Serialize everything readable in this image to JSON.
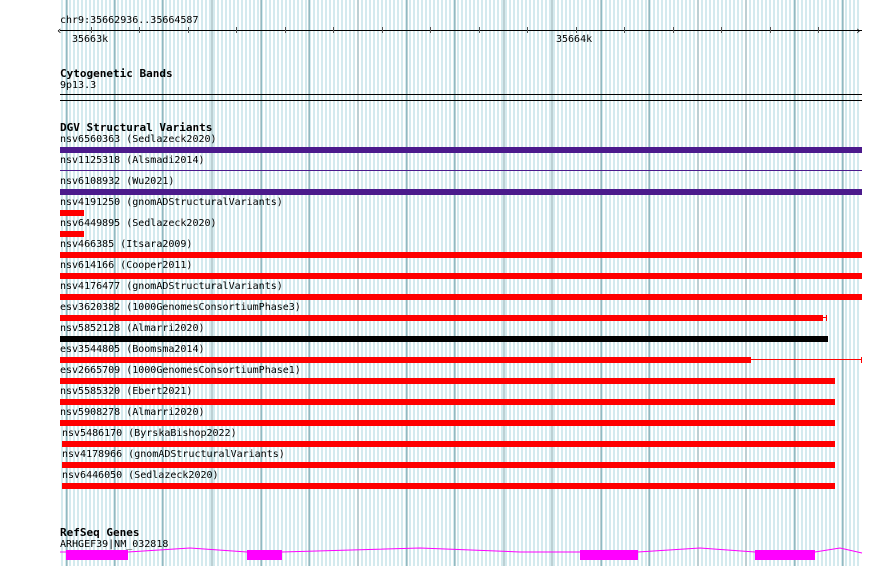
{
  "ruler": {
    "location": "chr9:35662936..35664587",
    "tick_labels": [
      "35663k",
      "35664k"
    ]
  },
  "cyto": {
    "title": "Cytogenetic Bands",
    "band": "9p13.3"
  },
  "dgv": {
    "title": "DGV Structural Variants",
    "variants": [
      {
        "label": "nsv6560363 (Sedlazeck2020)"
      },
      {
        "label": "nsv1125318 (Alsmadi2014)"
      },
      {
        "label": "nsv6108932 (Wu2021)"
      },
      {
        "label": "nsv4191250 (gnomADStructuralVariants)"
      },
      {
        "label": "nsv6449895 (Sedlazeck2020)"
      },
      {
        "label": "nsv466385 (Itsara2009)"
      },
      {
        "label": "nsv614166 (Cooper2011)"
      },
      {
        "label": "nsv4176477 (gnomADStructuralVariants)"
      },
      {
        "label": "esv3620382 (1000GenomesConsortiumPhase3)"
      },
      {
        "label": "nsv5852128 (Almarri2020)"
      },
      {
        "label": "esv3544805 (Boomsma2014)"
      },
      {
        "label": "esv2665709 (1000GenomesConsortiumPhase1)"
      },
      {
        "label": "nsv5585320 (Ebert2021)"
      },
      {
        "label": "nsv5908278 (Almarri2020)"
      },
      {
        "label": "nsv5486170 (ByrskaBishop2022)"
      },
      {
        "label": "nsv4178966 (gnomADStructuralVariants)"
      },
      {
        "label": "nsv6446050 (Sedlazeck2020)"
      }
    ]
  },
  "genes": {
    "title": "RefSeq Genes",
    "gene": "ARHGEF39|NM_032818"
  },
  "colors": {
    "grid": "#a8d4dc",
    "grid_major": "#7aa0a8",
    "purple": "#4b1a8c",
    "red": "#ff0000",
    "black": "#000000",
    "exon": "#ff00ff"
  }
}
